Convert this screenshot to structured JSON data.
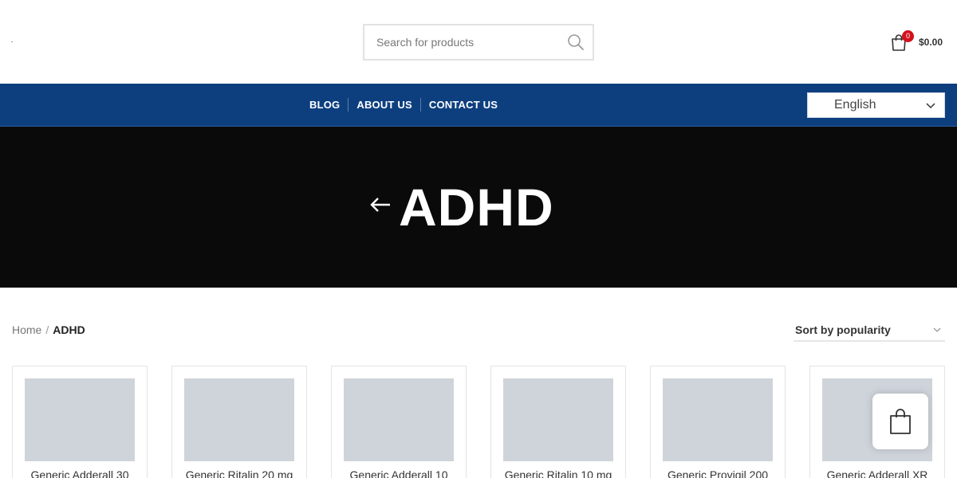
{
  "header": {
    "search": {
      "placeholder": "Search for products"
    },
    "cart": {
      "count": "0",
      "total": "$0.00"
    }
  },
  "nav": {
    "links": [
      "BLOG",
      "ABOUT US",
      "CONTACT US"
    ],
    "language": "English"
  },
  "hero": {
    "title": "ADHD"
  },
  "breadcrumb": {
    "home": "Home",
    "separator": "/",
    "current": "ADHD"
  },
  "sort": {
    "selected": "Sort by popularity"
  },
  "products": [
    {
      "title": "Generic Adderall 30"
    },
    {
      "title": "Generic Ritalin 20 mg"
    },
    {
      "title": "Generic Adderall 10"
    },
    {
      "title": "Generic Ritalin 10 mg"
    },
    {
      "title": "Generic Provigil 200"
    },
    {
      "title": "Generic Adderall XR"
    }
  ],
  "colors": {
    "nav_bg": "#0d3f7f",
    "hero_bg": "#0a0a0a",
    "badge": "#d3121c",
    "placeholder_image": "#cfd4db"
  }
}
